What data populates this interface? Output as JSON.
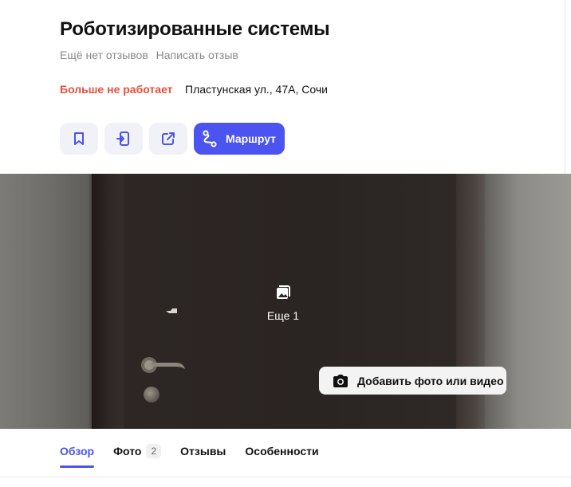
{
  "header": {
    "title": "Роботизированные системы",
    "reviews_text": "Ещё нет отзывов",
    "write_review": "Написать отзыв",
    "status": "Больше не работает",
    "address": "Пластунская ул., 47А, Сочи"
  },
  "actions": {
    "bookmark_icon": "bookmark-icon",
    "phone_icon": "send-to-phone-icon",
    "share_icon": "share-icon",
    "route_label": "Маршрут",
    "route_icon": "route-icon",
    "accent_color": "#4b53f0"
  },
  "photo": {
    "more_label": "Еще 1",
    "add_label": "Добавить фото или видео"
  },
  "tabs": [
    {
      "label": "Обзор",
      "active": true
    },
    {
      "label": "Фото",
      "count": "2"
    },
    {
      "label": "Отзывы"
    },
    {
      "label": "Особенности"
    }
  ],
  "colors": {
    "status_red": "#e94f3a",
    "muted_text": "#8a8a8a"
  }
}
